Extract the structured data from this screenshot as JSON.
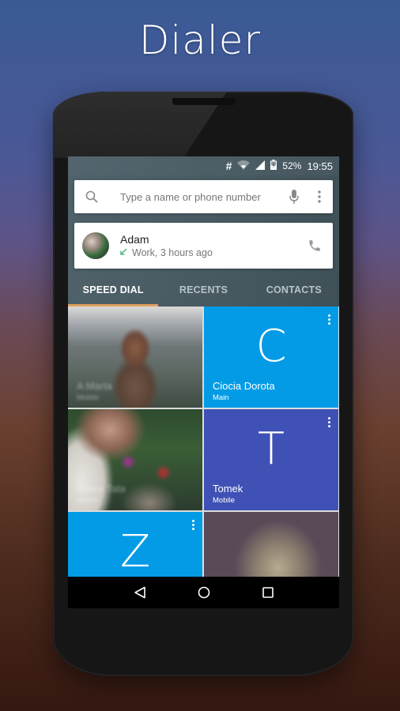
{
  "promo": {
    "title": "Dialer"
  },
  "status_bar": {
    "icons": [
      "hash-icon",
      "wifi-icon",
      "cell-signal-icon",
      "battery-charging-icon"
    ],
    "hash": "#",
    "battery": "52%",
    "time": "19:55"
  },
  "search": {
    "placeholder": "Type a name or phone number",
    "icons": [
      "search-icon",
      "mic-icon",
      "more-vert-icon"
    ]
  },
  "recent_call": {
    "name": "Adam",
    "detail": "Work, 3 hours ago",
    "call_type": "incoming",
    "call_type_color": "#3bb36b",
    "icon": "phone-icon"
  },
  "tabs": [
    {
      "label": "SPEED DIAL",
      "active": true
    },
    {
      "label": "RECENTS",
      "active": false
    },
    {
      "label": "CONTACTS",
      "active": false
    }
  ],
  "accent_color": "#e0a15f",
  "speed_dial": [
    {
      "type": "photo",
      "name": "A Marta",
      "label": "Mobile"
    },
    {
      "type": "letter",
      "letter": "C",
      "name": "Ciocia Dorota",
      "label": "Main",
      "color": "#039be5"
    },
    {
      "type": "photo",
      "name": "Adam Tata",
      "label": "Mobile"
    },
    {
      "type": "letter",
      "letter": "T",
      "name": "Tomek",
      "label": "Mobile",
      "color": "#3f51b5"
    },
    {
      "type": "letter",
      "letter": "Z",
      "name": "",
      "label": "",
      "color": "#039be5"
    },
    {
      "type": "photo",
      "name": "",
      "label": ""
    }
  ],
  "fab": {
    "icon": "dialpad-icon",
    "color": "#d19a57"
  },
  "nav_bar": {
    "icons": [
      "back-icon",
      "home-icon",
      "recents-icon"
    ]
  }
}
